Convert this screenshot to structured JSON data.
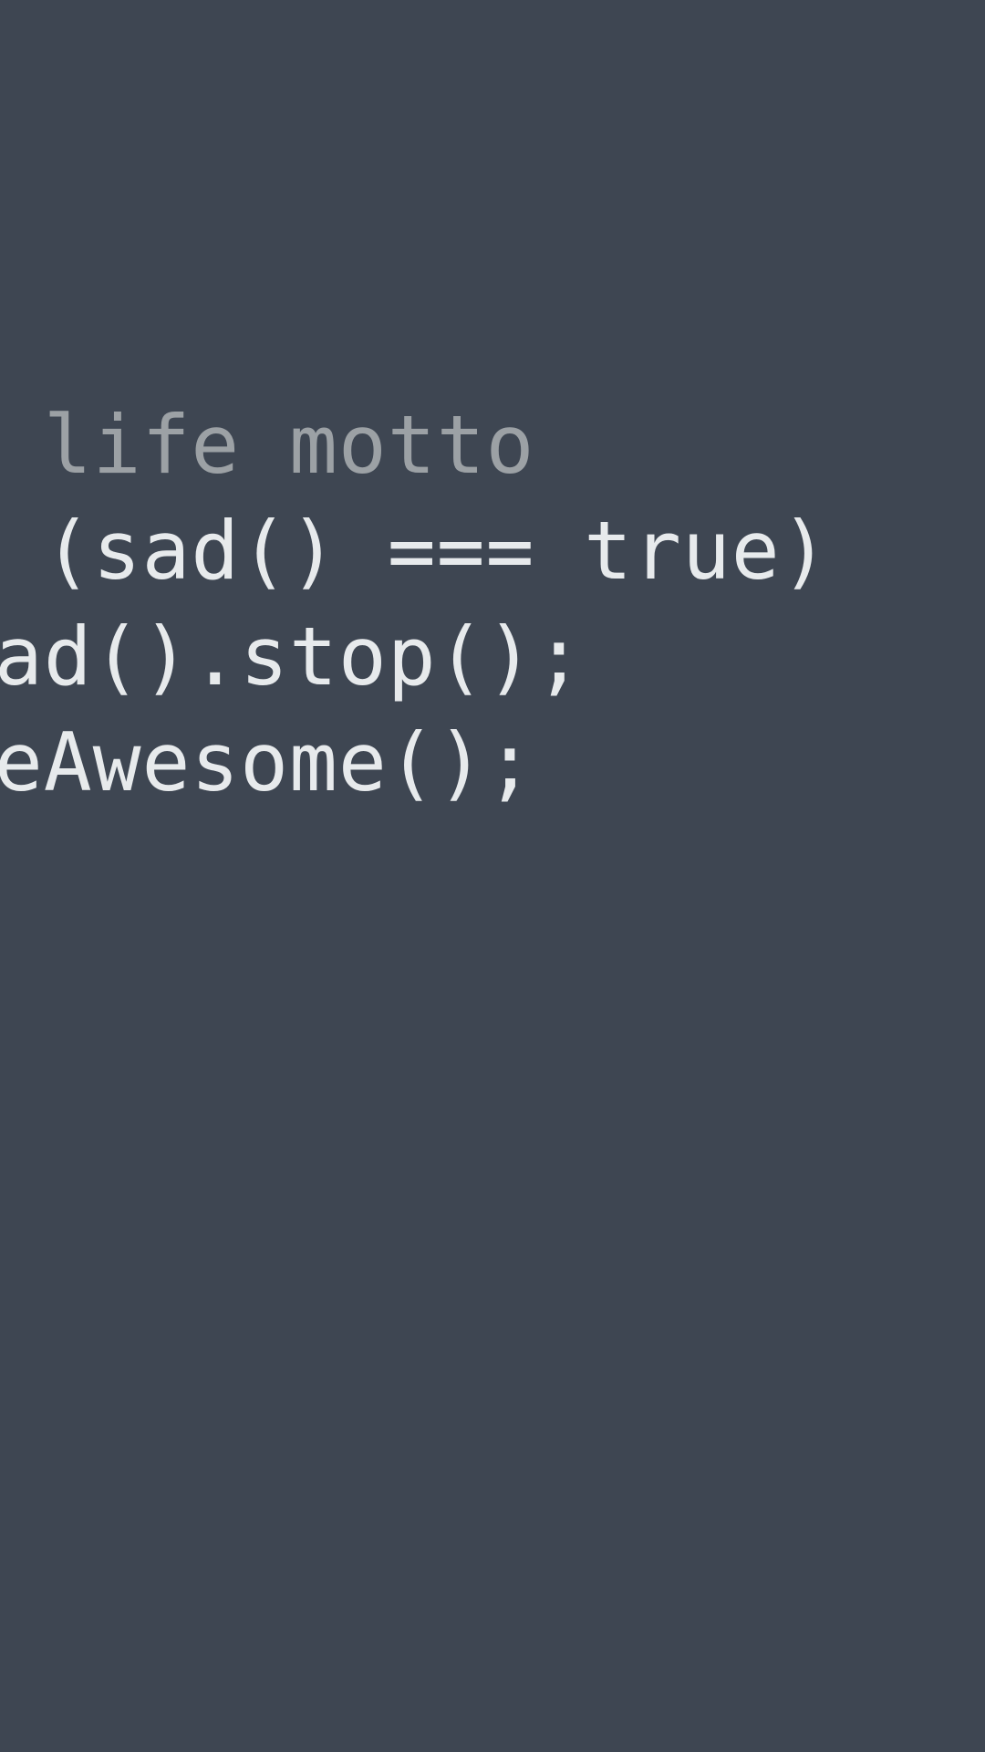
{
  "colors": {
    "background": "#3e4652",
    "comment": "#9ca1a5",
    "code": "#e7eaec"
  },
  "code": {
    "line1": "/ life motto",
    "line2": "f (sad() === true)",
    "line3": "sad().stop();",
    "line4": "beAwesome();"
  }
}
